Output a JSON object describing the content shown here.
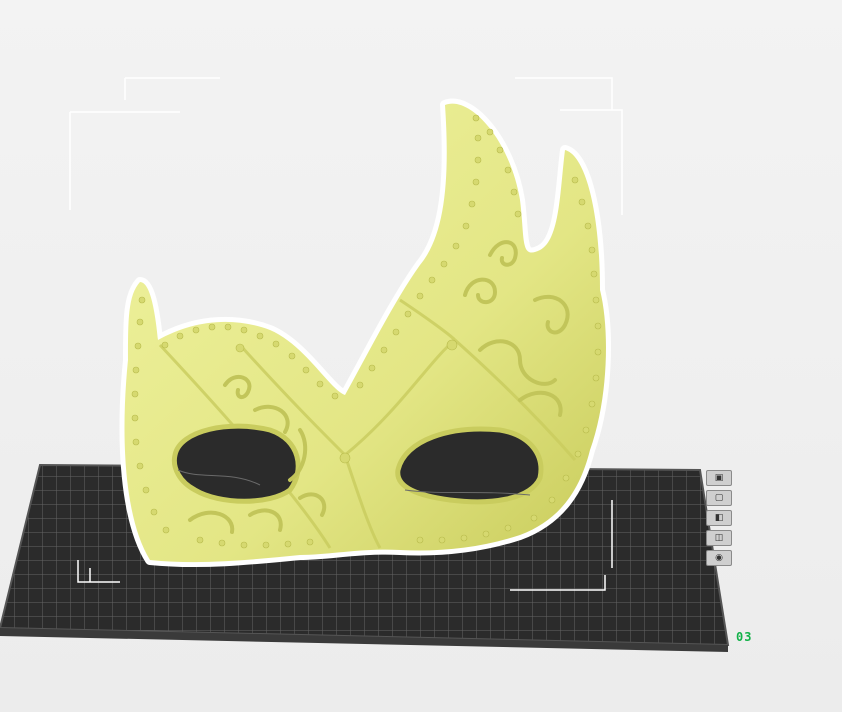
{
  "viewport": {
    "plate_label": "03",
    "model_color": "#e9ec8f",
    "model_shadow": "#c9cc5e",
    "plate_color": "#2c2c2c",
    "grid_color": "#707070",
    "outline_color": "#ffffff",
    "accent_color": "#14b24a"
  },
  "side_tools": [
    {
      "icon": "view-cube-icon",
      "glyph": "▣"
    },
    {
      "icon": "front-view-icon",
      "glyph": "▢"
    },
    {
      "icon": "side-view-icon",
      "glyph": "◧"
    },
    {
      "icon": "top-view-icon",
      "glyph": "◫"
    },
    {
      "icon": "camera-icon",
      "glyph": "◉"
    }
  ]
}
